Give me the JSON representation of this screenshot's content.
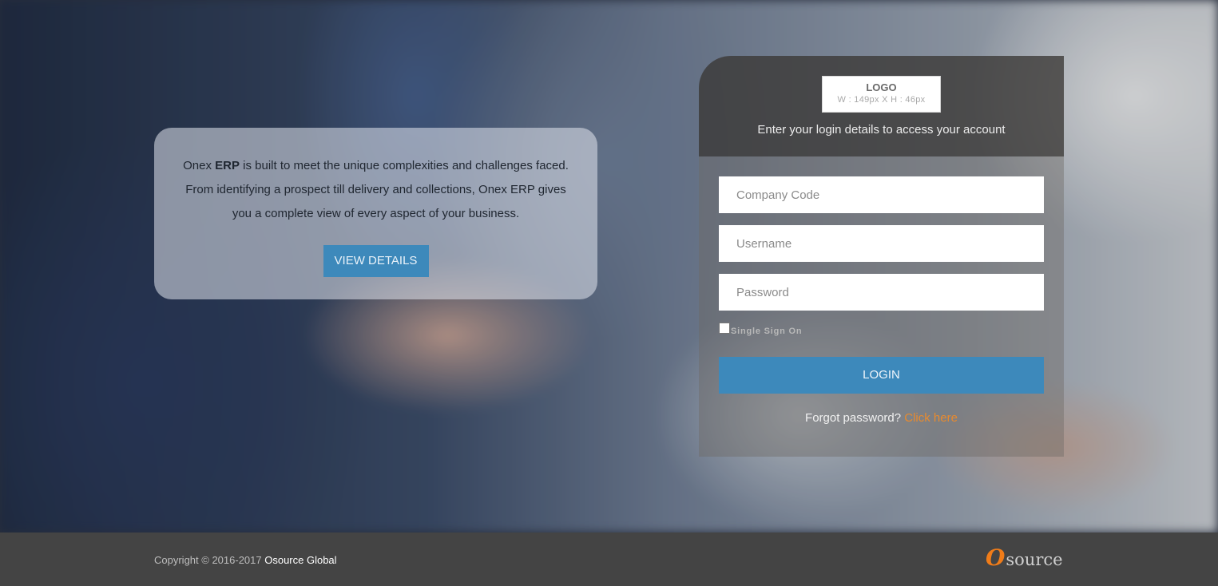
{
  "info": {
    "text_pre": "Onex ",
    "text_bold": "ERP",
    "text_post": " is built to meet the unique complexities and challenges faced. From identifying a prospect till delivery and collections, Onex ERP gives you a complete view of every aspect of your business.",
    "button_label": "VIEW DETAILS"
  },
  "login": {
    "logo_title": "LOGO",
    "logo_dimensions": "W : 149px  X  H : 46px",
    "subtitle": "Enter your login details to access your account",
    "company_placeholder": "Company Code",
    "username_placeholder": "Username",
    "password_placeholder": "Password",
    "sso_label": "Single Sign On",
    "sso_checked": false,
    "button_label": "LOGIN",
    "forgot_text": "Forgot password?",
    "forgot_link": "Click here"
  },
  "footer": {
    "copyright": "Copyright © 2016-2017",
    "company": "Osource Global",
    "brand_o": "O",
    "brand_rest": "source"
  },
  "colors": {
    "accent": "#3d89bb",
    "link": "#e88a2e",
    "footer_bg": "#444444"
  }
}
